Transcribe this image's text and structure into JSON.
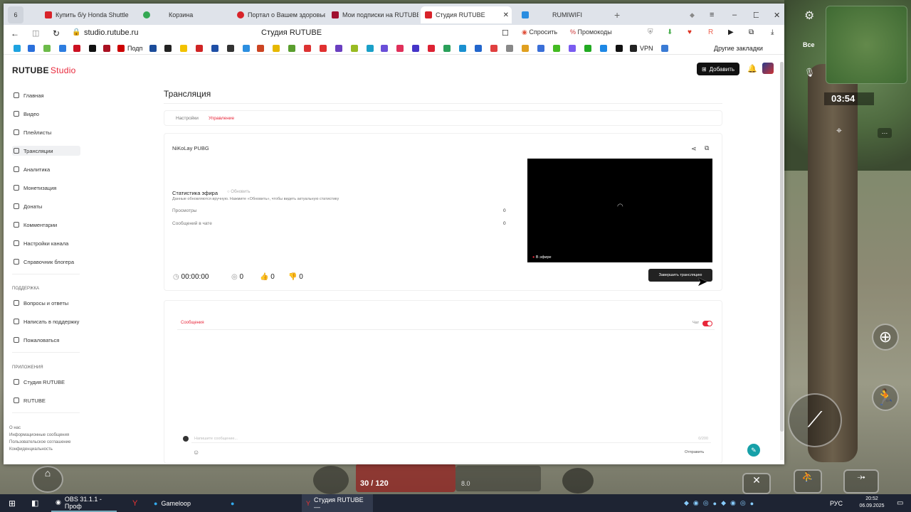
{
  "browser": {
    "tab_count": "6",
    "tabs": [
      {
        "label": "Купить б/у Honda Shuttle",
        "color": "#d8232a"
      },
      {
        "label": "",
        "color": "#34a853"
      },
      {
        "label": "Корзина",
        "color": ""
      },
      {
        "label": "Портал о Вашем здоровье",
        "color": "#d8232a"
      },
      {
        "label": "Мои подписки на RUTUBE",
        "color": "#a01030"
      },
      {
        "label": "Студия RUTUBE",
        "color": "#d8232a"
      },
      {
        "label": "RUMIWIFI",
        "color": "#2a8de0"
      }
    ],
    "url": "studio.rutube.ru",
    "page_title": "Студия RUTUBE",
    "ask_label": "Спросить",
    "promo_label": "Промокоды",
    "bookmark_podp": "Подп",
    "bookmark_vpn": "VPN",
    "other_bookmarks": "Другие закладки"
  },
  "studio": {
    "logo": "RUTUBE",
    "logo_suffix": "Studio",
    "add_button": "Добавить",
    "nav": [
      "Главная",
      "Видео",
      "Плейлисты",
      "Трансляции",
      "Аналитика",
      "Монетизация",
      "Донаты",
      "Комментарии",
      "Настройки канала",
      "Справочник блогера"
    ],
    "support_heading": "ПОДДЕРЖКА",
    "support": [
      "Вопросы и ответы",
      "Написать в поддержку",
      "Пожаловаться"
    ],
    "apps_heading": "ПРИЛОЖЕНИЯ",
    "apps": [
      "Студия RUTUBE",
      "RUTUBE"
    ],
    "footer": [
      "О нас",
      "Информационные сообщения",
      "Пользовательское соглашение",
      "Конфиденциальность"
    ],
    "page_heading": "Трансляция",
    "tabs": [
      "Настройки",
      "Управление"
    ],
    "stream_name": "NiKoLay PUBG",
    "stats_title": "Статистика эфира",
    "refresh_label": "Обновить",
    "stats_hint": "Данные обновляются вручную. Нажмите «Обновить», чтобы видеть актуальную статистику",
    "stats": [
      {
        "label": "Просмотры",
        "value": "0"
      },
      {
        "label": "Сообщений в чате",
        "value": "0"
      }
    ],
    "duration": "00:00:00",
    "viewers": "0",
    "likes": "0",
    "dislikes": "0",
    "live_badge": "В эфире",
    "end_button": "Завершить трансляцию",
    "chat_tab": "Сообщения",
    "chat_toggle_label": "Чат",
    "message_placeholder": "Напишите сообщение...",
    "char_counter": "0/200",
    "send_label": "Отправить"
  },
  "game": {
    "timer": "03:54",
    "ammo": "30 / 120",
    "scope": "8.0"
  },
  "taskbar": {
    "obs": "OBS 31.1.1 - Проф",
    "gameloop": "Gameloop",
    "studio": "Студия RUTUBE —",
    "lang": "РУС",
    "time": "20:52",
    "date": "06.09.2025"
  }
}
